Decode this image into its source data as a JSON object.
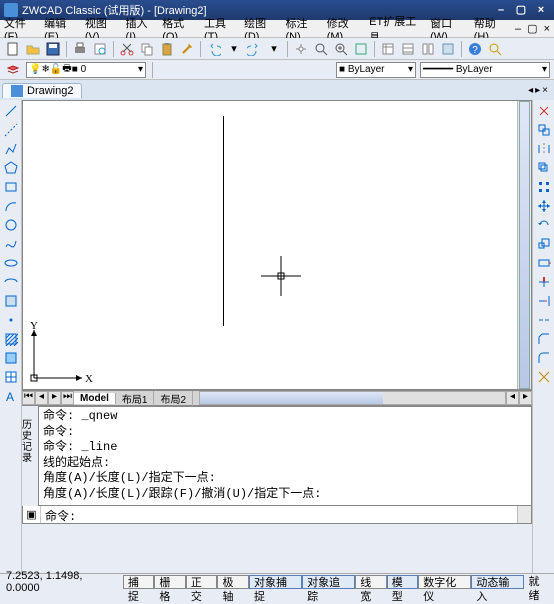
{
  "title": "ZWCAD Classic (试用版) - [Drawing2]",
  "menu": [
    "文件(F)",
    "编辑(E)",
    "视图(V)",
    "插入(I)",
    "格式(O)",
    "工具(T)",
    "绘图(D)",
    "标注(N)",
    "修改(M)",
    "ET扩展工具",
    "窗口(W)",
    "帮助(H)"
  ],
  "layer_combo": "0",
  "bylayer1": "■ ByLayer",
  "bylayer2": "━━━━━ ByLayer",
  "doc_tab": "Drawing2",
  "ucs": {
    "x": "X",
    "y": "Y"
  },
  "model_tabs": {
    "model": "Model",
    "layout1": "布局1",
    "layout2": "布局2"
  },
  "cmd_side": "历史记录",
  "cmd_log": "命令: _qnew\n命令:\n命令: _line\n线的起始点:\n角度(A)/长度(L)/指定下一点:\n角度(A)/长度(L)/跟踪(F)/撤消(U)/指定下一点:",
  "cmd_prompt": "命令:",
  "status": {
    "coords": "7.2523, 1.1498, 0.0000",
    "buttons": [
      "捕捉",
      "栅格",
      "正交",
      "极轴",
      "对象捕捉",
      "对象追踪",
      "线宽",
      "模型",
      "数字化仪",
      "动态输入",
      "就绪"
    ]
  },
  "toolbar_icons": [
    "new",
    "open",
    "save",
    "print",
    "preview",
    "cut",
    "copy",
    "paste",
    "match",
    "undo",
    "redo",
    "pan",
    "zoom-win",
    "zoom-extents",
    "zoom-realtime",
    "props",
    "layers",
    "tool-palette",
    "plot",
    "help",
    "about"
  ],
  "left_tools": [
    "line",
    "construction-line",
    "polyline",
    "polygon",
    "rectangle",
    "arc",
    "circle",
    "spline",
    "ellipse",
    "ellipse-arc",
    "block",
    "point",
    "hatch",
    "region",
    "table",
    "text",
    "mtext"
  ],
  "right_tools": [
    "erase",
    "copy",
    "mirror",
    "offset",
    "array",
    "move",
    "rotate",
    "scale",
    "stretch",
    "trim",
    "extend",
    "break",
    "chamfer",
    "fillet",
    "explode"
  ]
}
